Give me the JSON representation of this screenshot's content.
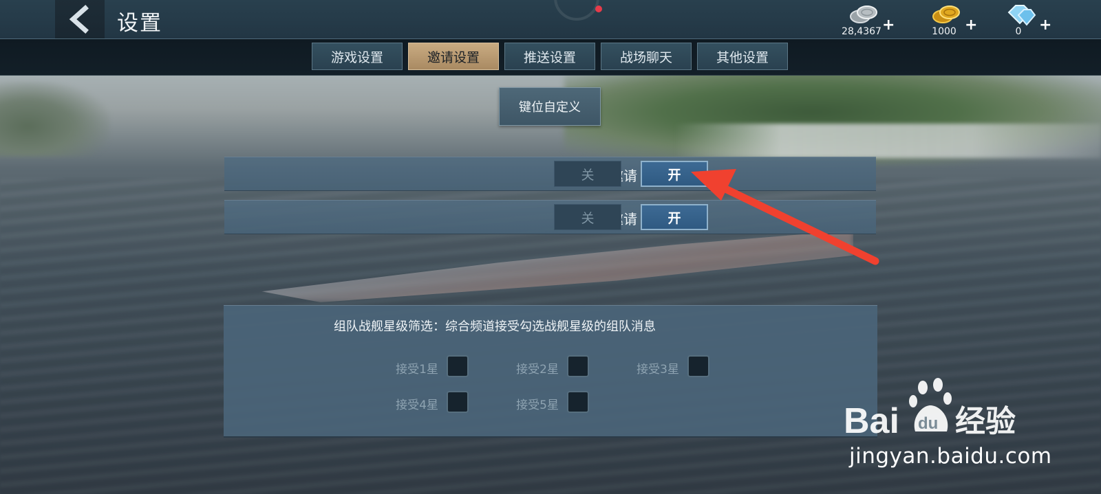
{
  "header": {
    "title": "设置",
    "currencies": [
      {
        "icon": "silver-coins-icon",
        "value": "28,4367",
        "plus": "+"
      },
      {
        "icon": "gold-coins-icon",
        "value": "1000",
        "plus": "+"
      },
      {
        "icon": "diamond-icon",
        "value": "0",
        "plus": "+"
      }
    ]
  },
  "tabs": [
    {
      "label": "游戏设置",
      "active": false
    },
    {
      "label": "邀请设置",
      "active": true
    },
    {
      "label": "推送设置",
      "active": false
    },
    {
      "label": "战场聊天",
      "active": false
    },
    {
      "label": "其他设置",
      "active": false
    }
  ],
  "key_custom_button": "键位自定义",
  "invite_rows": [
    {
      "label": "好友组队邀请",
      "off_label": "关",
      "on_label": "开",
      "state": "on"
    },
    {
      "label": "舰队组队邀请",
      "off_label": "关",
      "on_label": "开",
      "state": "on"
    }
  ],
  "star_filter": {
    "description": "组队战舰星级筛选：综合频道接受勾选战舰星级的组队消息",
    "options": [
      {
        "label": "接受1星",
        "checked": false
      },
      {
        "label": "接受2星",
        "checked": false
      },
      {
        "label": "接受3星",
        "checked": false
      },
      {
        "label": "接受4星",
        "checked": false
      },
      {
        "label": "接受5星",
        "checked": false
      }
    ]
  },
  "watermark": {
    "logo_text": "Bai",
    "logo_du": "du",
    "logo_cn": "经验",
    "url": "jingyan.baidu.com"
  },
  "colors": {
    "active_tab": "#c9ab82",
    "toggle_on": "#2f5a82",
    "annotation_arrow": "#f0412f"
  }
}
